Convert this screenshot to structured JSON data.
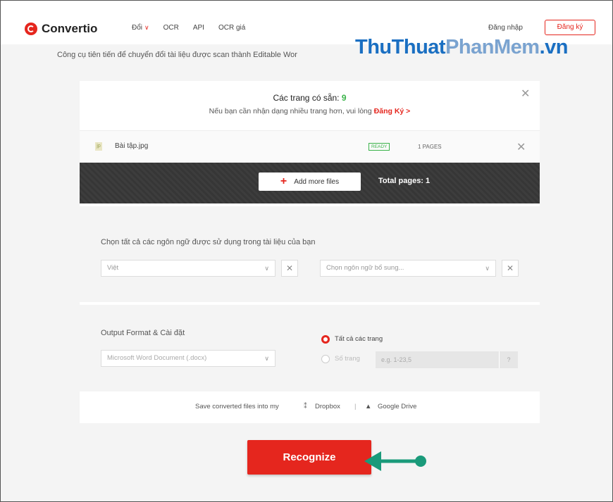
{
  "header": {
    "logo_text": "Convertio",
    "nav": [
      "Đổi",
      "OCR",
      "API",
      "OCR giá"
    ],
    "login": "Đăng nhập",
    "signup": "Đăng ký"
  },
  "tagline": "Công cụ tiên tiến để chuyển đổi tài liệu được scan thành Editable Wor",
  "watermark": {
    "part1": "ThuThuat",
    "part2": "PhanMem",
    "part3": ".vn"
  },
  "avail": {
    "title": "Các trang có sẵn: ",
    "count": "9",
    "sub": "Nếu bạn cần nhận dạng nhiều trang hơn, vui lòng ",
    "link": "Đăng Ký",
    "link_arrow": ">"
  },
  "file": {
    "name": "Bài tập.jpg",
    "status": "READY",
    "pages": "1 PAGES"
  },
  "add_more": "Add more files",
  "total_pages": "Total pages: 1",
  "languages": {
    "label": "Chọn tất cả các ngôn ngữ được sử dụng trong tài liệu của bạn",
    "primary": "Việt",
    "secondary_placeholder": "Chọn ngôn ngữ bổ sung..."
  },
  "output": {
    "label": "Output Format & Cài đặt",
    "format": "Microsoft Word Document (.docx)",
    "all_pages": "Tất cả các trang",
    "page_num": "Số trang",
    "page_placeholder": "e.g. 1-23,5",
    "help": "?"
  },
  "save": {
    "text": "Save converted files into my",
    "dropbox": "Dropbox",
    "sep": "|",
    "gdrive": "Google Drive"
  },
  "recognize": "Recognize",
  "colors": {
    "accent": "#e5261e",
    "ready": "#3bb34a",
    "arrow": "#1a9a7a"
  },
  "icons": [
    "logo-icon",
    "chevron-down-icon",
    "close-icon",
    "file-icon",
    "plus-icon",
    "radio-selected-icon",
    "dropbox-icon",
    "google-drive-icon",
    "arrow-icon"
  ]
}
